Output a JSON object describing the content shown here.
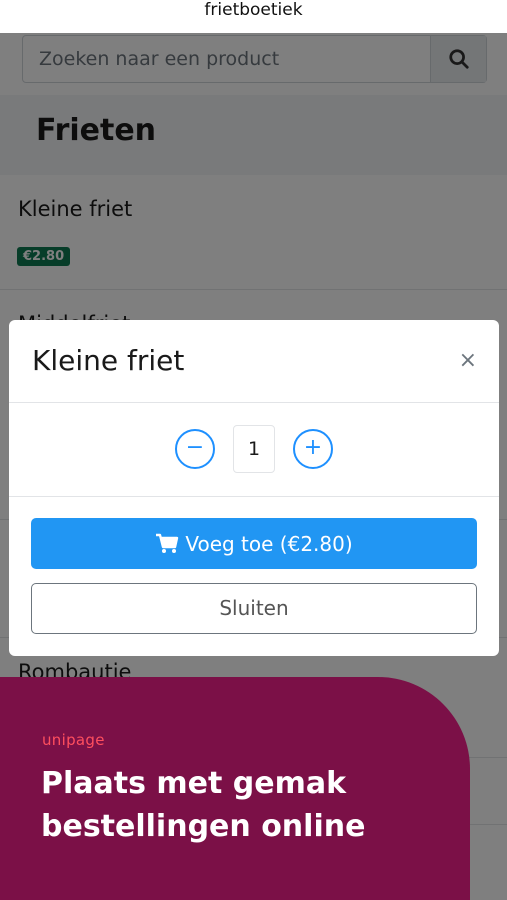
{
  "app": {
    "title": "frietboetiek"
  },
  "search": {
    "placeholder": "Zoeken naar een product",
    "icon": "search-icon"
  },
  "category": {
    "title": "Frieten"
  },
  "items": [
    {
      "name": "Kleine friet",
      "price": "€2.80"
    },
    {
      "name": "Middelfriet"
    },
    {
      "name": "Rombautje"
    }
  ],
  "modal": {
    "title": "Kleine friet",
    "close_symbol": "×",
    "minus": "−",
    "plus": "+",
    "quantity": "1",
    "add_label": "Voeg toe (€2.80)",
    "add_icon": "cart-icon",
    "close_label": "Sluiten"
  },
  "promo": {
    "brand": "unipage",
    "headline": "Plaats met gemak bestellingen online",
    "background": "#7b1047",
    "brand_color": "#ff4f5e"
  },
  "colors": {
    "primary": "#2196f3",
    "price_badge": "#0e7a52"
  }
}
